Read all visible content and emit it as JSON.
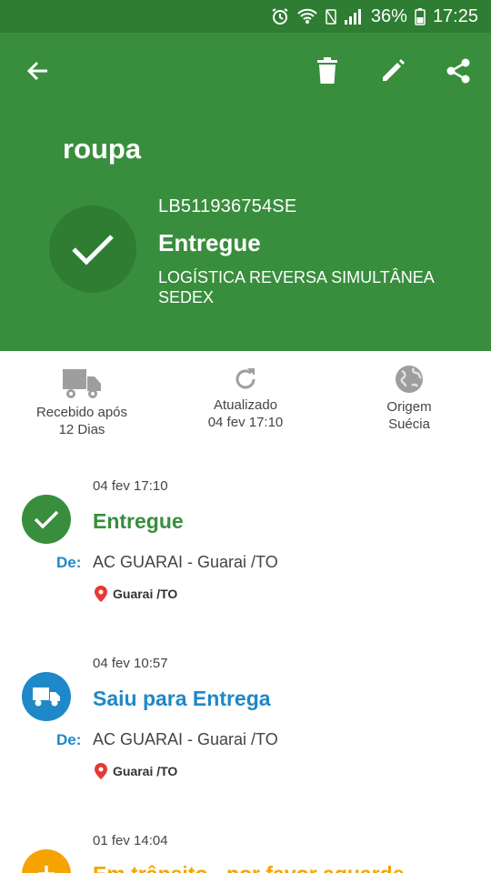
{
  "status_bar": {
    "battery": "36%",
    "time": "17:25"
  },
  "header": {
    "title": "roupa",
    "tracking_code": "LB511936754SE",
    "status": "Entregue",
    "service_line1": "LOGÍSTICA REVERSA SIMULTÂNEA",
    "service_line2": "SEDEX"
  },
  "stats": [
    {
      "icon": "truck-icon",
      "line1": "Recebido após",
      "line2": "12 Dias"
    },
    {
      "icon": "refresh-icon",
      "line1": "Atualizado",
      "line2": "04 fev 17:10"
    },
    {
      "icon": "globe-icon",
      "line1": "Origem",
      "line2": "Suécia"
    }
  ],
  "events": [
    {
      "date": "04 fev 17:10",
      "title": "Entregue",
      "de_label": "De:",
      "location": "AC GUARAI - Guarai /TO",
      "pin": "Guarai /TO",
      "color": "#388e3c",
      "icon": "check-icon"
    },
    {
      "date": "04 fev 10:57",
      "title": "Saiu para Entrega",
      "de_label": "De:",
      "location": "AC GUARAI - Guarai /TO",
      "pin": "Guarai /TO",
      "color": "#1e88c8",
      "icon": "truck-icon"
    },
    {
      "date": "01 fev 14:04",
      "title": "Em trânsito - por favor aguarde",
      "color": "#f5a300",
      "icon": "plus-icon"
    }
  ],
  "colors": {
    "header": "#388e3c",
    "status_bar": "#2e7d32",
    "circle": "#2e7d32",
    "de_label": "#1e88c8"
  }
}
